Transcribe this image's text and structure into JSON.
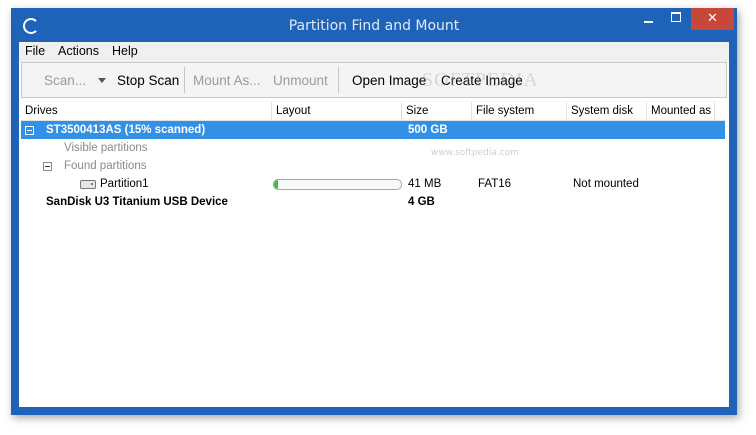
{
  "window": {
    "title": "Partition Find and Mount",
    "close_glyph": "✕"
  },
  "menu": [
    "File",
    "Actions",
    "Help"
  ],
  "toolbar": {
    "scan": "Scan...",
    "stop_scan": "Stop Scan",
    "mount_as": "Mount As...",
    "unmount": "Unmount",
    "open_image": "Open Image",
    "create_image": "Create Image"
  },
  "watermark": "SOFTPEDIA",
  "watermark_url": "www.softpedia.com",
  "columns": [
    "Drives",
    "Layout",
    "Size",
    "File system",
    "System disk",
    "Mounted as"
  ],
  "rows": [
    {
      "name": "ST3500413AS  (15% scanned)",
      "size": "500 GB"
    },
    {
      "name": "Visible partitions"
    },
    {
      "name": "Found partitions"
    },
    {
      "name": "Partition1",
      "layout_fraction": 0.03,
      "size": "41 MB",
      "file_system": "FAT16",
      "system_disk": "Not mounted"
    },
    {
      "name": "SanDisk U3 Titanium USB Device",
      "size": "4 GB"
    }
  ],
  "colors": {
    "titlebar": "#1e63b8",
    "selection": "#3390e7",
    "close_button": "#c7483b",
    "layout_fill": "#3bbf3b"
  },
  "icons": [
    "app-icon",
    "minimize-icon",
    "maximize-icon",
    "close-icon",
    "dropdown-arrow-icon",
    "collapse-icon",
    "drive-icon"
  ]
}
